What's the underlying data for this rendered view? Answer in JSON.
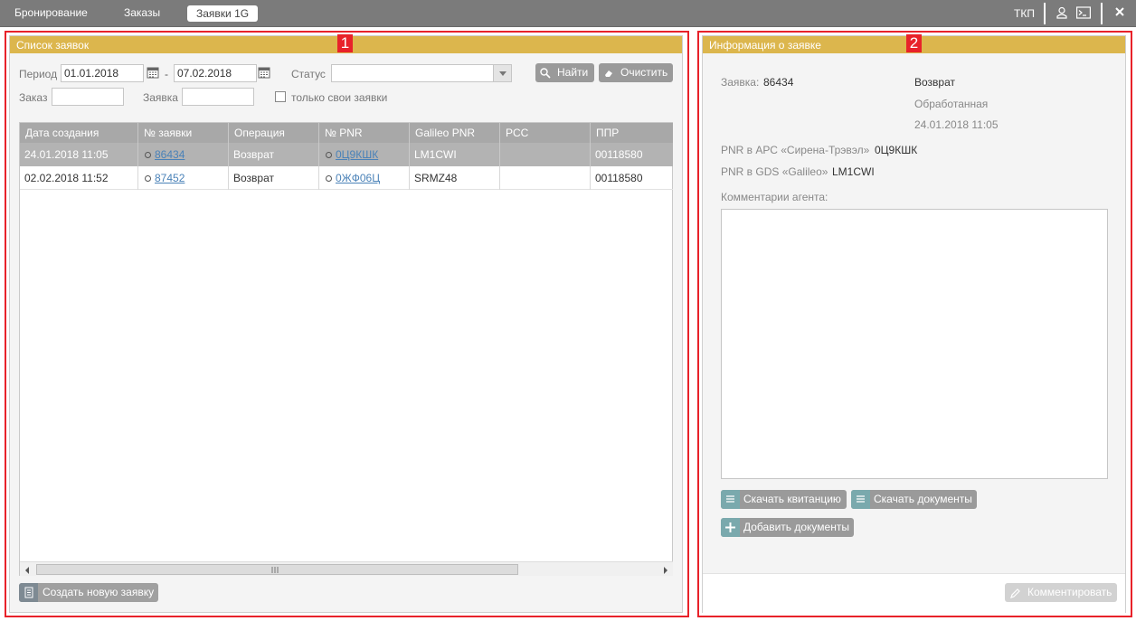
{
  "topbar": {
    "tabs": [
      {
        "label": "Бронирование"
      },
      {
        "label": "Заказы"
      },
      {
        "label": "Заявки 1G"
      }
    ],
    "right_text": "ТКП"
  },
  "left_panel": {
    "title": "Список заявок",
    "marker": "1",
    "filters": {
      "period_label": "Период",
      "date_from": "01.01.2018",
      "dash": "-",
      "date_to": "07.02.2018",
      "status_label": "Статус",
      "status_value": "",
      "order_label": "Заказ",
      "order_value": "",
      "request_label": "Заявка",
      "request_value": "",
      "own_only_label": "только свои заявки",
      "find_button": "Найти",
      "clear_button": "Очистить"
    },
    "table": {
      "columns": [
        "Дата создания",
        "№ заявки",
        "Операция",
        "№ PNR",
        "Galileo PNR",
        "PCC",
        "ППР"
      ],
      "rows": [
        {
          "date": "24.01.2018 11:05",
          "number": "86434",
          "operation": "Возврат",
          "pnr": "0Ц9КШК",
          "galileo": "LM1CWI",
          "pcc": "",
          "ppr": "00118580"
        },
        {
          "date": "02.02.2018 11:52",
          "number": "87452",
          "operation": "Возврат",
          "pnr": "0ЖФ06Ц",
          "galileo": "SRMZ48",
          "pcc": "",
          "ppr": "00118580"
        }
      ]
    },
    "create_button": "Создать новую заявку"
  },
  "right_panel": {
    "title": "Информация о заявке",
    "marker": "2",
    "request_label": "Заявка:",
    "request_value": "86434",
    "operation": "Возврат",
    "state": "Обработанная",
    "datetime": "24.01.2018 11:05",
    "pnr_arc_label": "PNR в АРС «Сирена-Трэвэл»",
    "pnr_arc_value": "0Ц9КШК",
    "pnr_gds_label": "PNR в GDS «Galileo»",
    "pnr_gds_value": "LM1CWI",
    "comments_label": "Комментарии агента:",
    "download_receipt": "Скачать квитанцию",
    "download_docs": "Скачать документы",
    "add_docs": "Добавить документы",
    "comment_button": "Комментировать"
  }
}
